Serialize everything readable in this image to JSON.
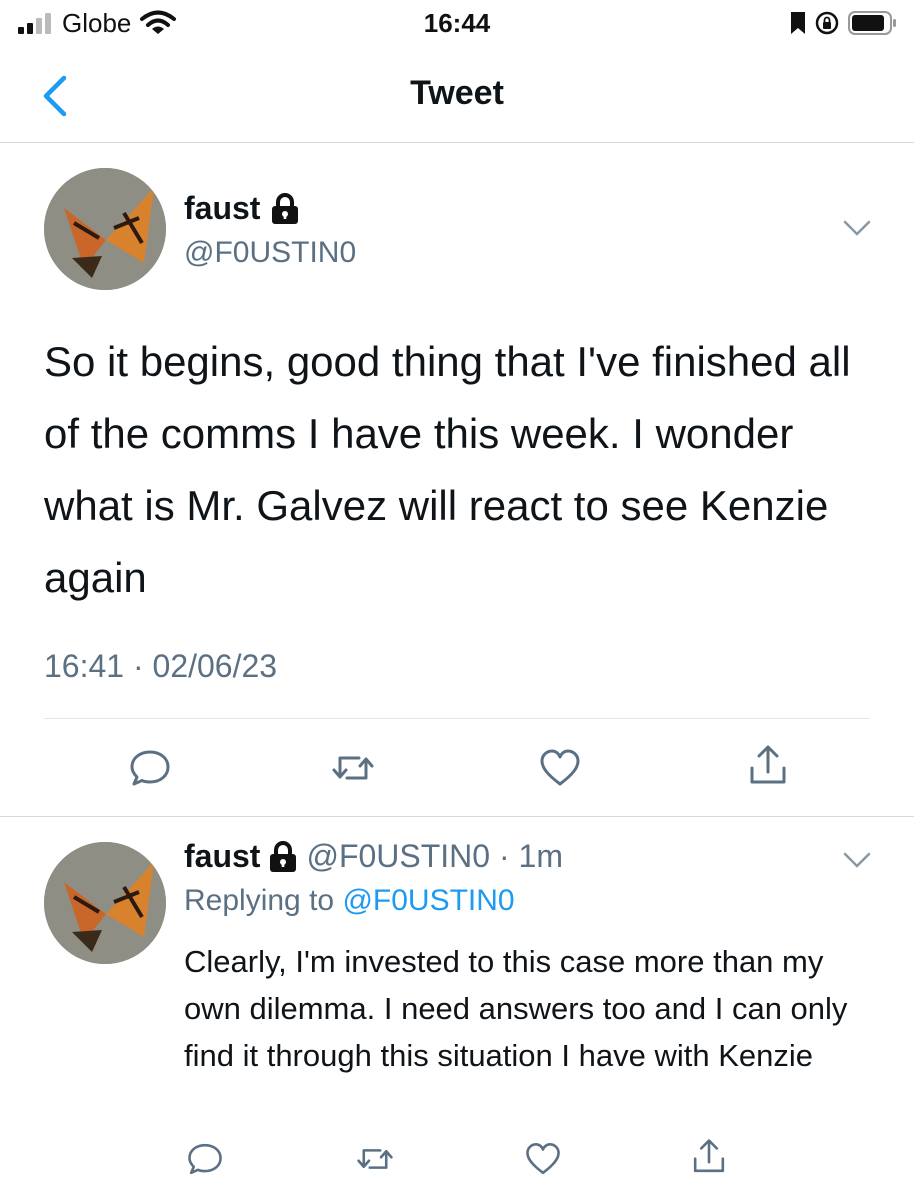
{
  "status_bar": {
    "carrier": "Globe",
    "time": "16:44",
    "icons": [
      "signal-bars-icon",
      "wifi-icon",
      "bookmark-icon",
      "rotation-lock-icon",
      "battery-icon"
    ]
  },
  "nav": {
    "title": "Tweet",
    "back_icon": "chevron-left-icon"
  },
  "main_tweet": {
    "name": "faust",
    "handle": "@F0USTIN0",
    "protected_icon": "lock-icon",
    "body": "So it begins, good thing that I've finished all of the comms I have this week. I wonder what is Mr. Galvez will react to see Kenzie again",
    "timestamp": "16:41 · 02/06/23",
    "actions": [
      "reply-icon",
      "retweet-icon",
      "like-icon",
      "share-icon"
    ]
  },
  "reply_tweet": {
    "name": "faust",
    "handle_time": "@F0USTIN0 · 1m",
    "replying_prefix": "Replying to",
    "replying_to": "@F0USTIN0",
    "body": "Clearly, I'm invested to this case more than my own dilemma. I need answers too and I can only find it through this situation I have with Kenzie",
    "actions": [
      "reply-icon",
      "retweet-icon",
      "like-icon",
      "share-icon"
    ]
  },
  "colors": {
    "accent": "#1d9bf0",
    "secondary_text": "#5b7083",
    "primary_text": "#0f1419"
  }
}
